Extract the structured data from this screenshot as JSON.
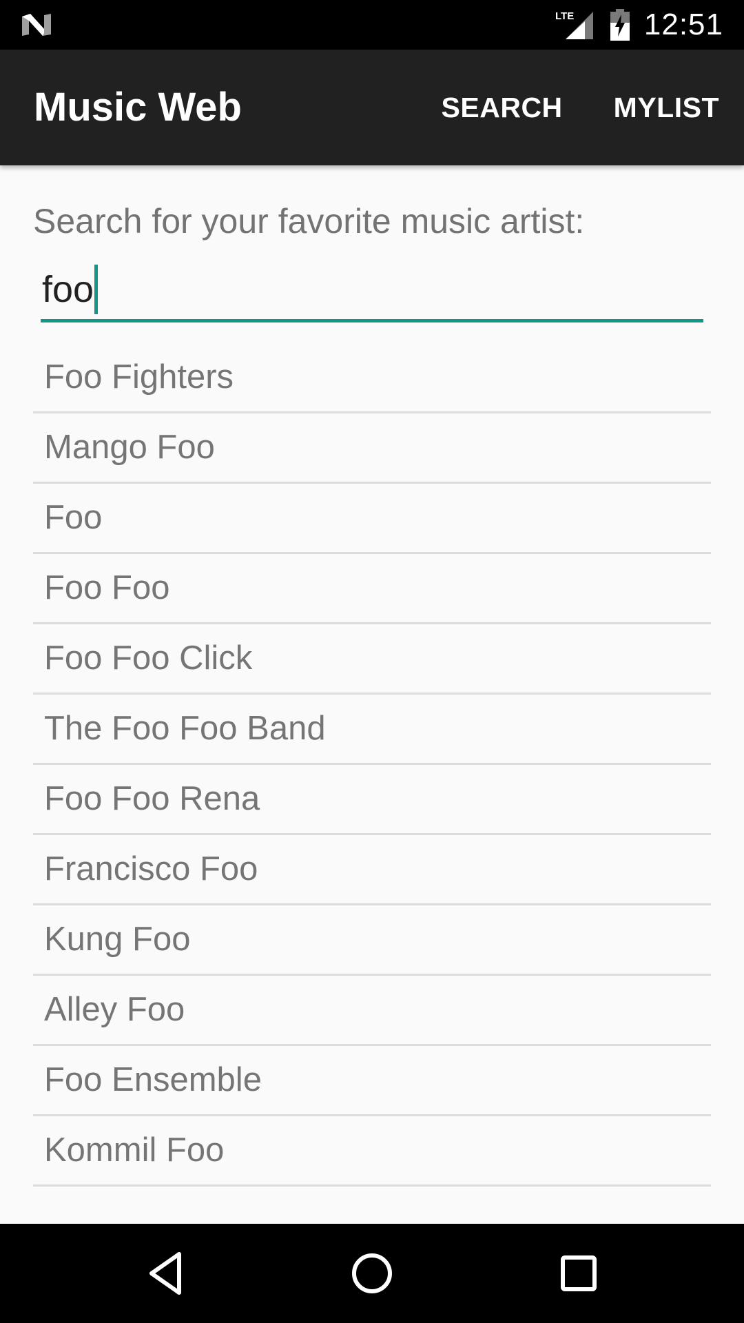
{
  "status_bar": {
    "network": "LTE",
    "time": "12:51"
  },
  "app_bar": {
    "title": "Music Web",
    "actions": [
      {
        "label": "SEARCH"
      },
      {
        "label": "MYLIST"
      }
    ]
  },
  "search": {
    "prompt": "Search for your favorite music artist:",
    "value": "foo"
  },
  "results": [
    {
      "label": "Foo Fighters"
    },
    {
      "label": "Mango Foo"
    },
    {
      "label": "Foo"
    },
    {
      "label": "Foo Foo"
    },
    {
      "label": "Foo Foo Click"
    },
    {
      "label": "The Foo Foo Band"
    },
    {
      "label": "Foo Foo Rena"
    },
    {
      "label": "Francisco Foo"
    },
    {
      "label": "Kung Foo"
    },
    {
      "label": "Alley Foo"
    },
    {
      "label": "Foo Ensemble"
    },
    {
      "label": "Kommil Foo"
    }
  ],
  "colors": {
    "app_bar": "#212121",
    "accent": "#139688",
    "background": "#fafafa",
    "list_text": "#757575"
  },
  "icons": {
    "status_logo": "n-logo-icon",
    "signal": "lte-signal-icon",
    "battery": "battery-charging-icon",
    "nav_back": "back-triangle-icon",
    "nav_home": "home-circle-icon",
    "nav_recents": "recents-square-icon"
  }
}
